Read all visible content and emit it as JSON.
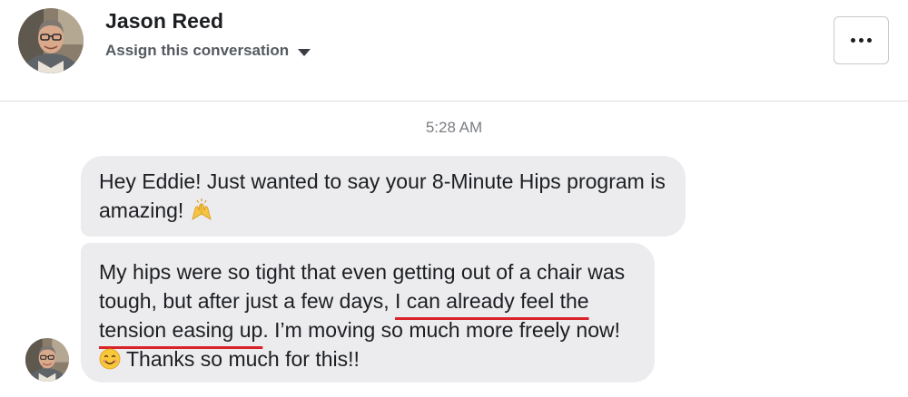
{
  "contact": {
    "name": "Jason Reed",
    "assign_label": "Assign this conversation"
  },
  "header": {
    "more_icon": "more-horizontal-icon"
  },
  "timestamp": "5:28 AM",
  "messages": [
    {
      "text_before": "Hey Eddie! Just wanted to say your 8-Minute Hips program is amazing!",
      "emoji": "raising-hands-icon"
    },
    {
      "text_before": "My hips were so tight that even getting out of a chair was tough, but after just a few days,",
      "highlight": "I can already feel the tension easing up",
      "text_after": ". I’m moving so much more freely now!",
      "emoji": "smiling-face-icon",
      "text_end": "Thanks so much for this!!"
    }
  ],
  "colors": {
    "bubble": "#ececee",
    "underline": "#d8232a",
    "divider": "#dcdcdc"
  }
}
